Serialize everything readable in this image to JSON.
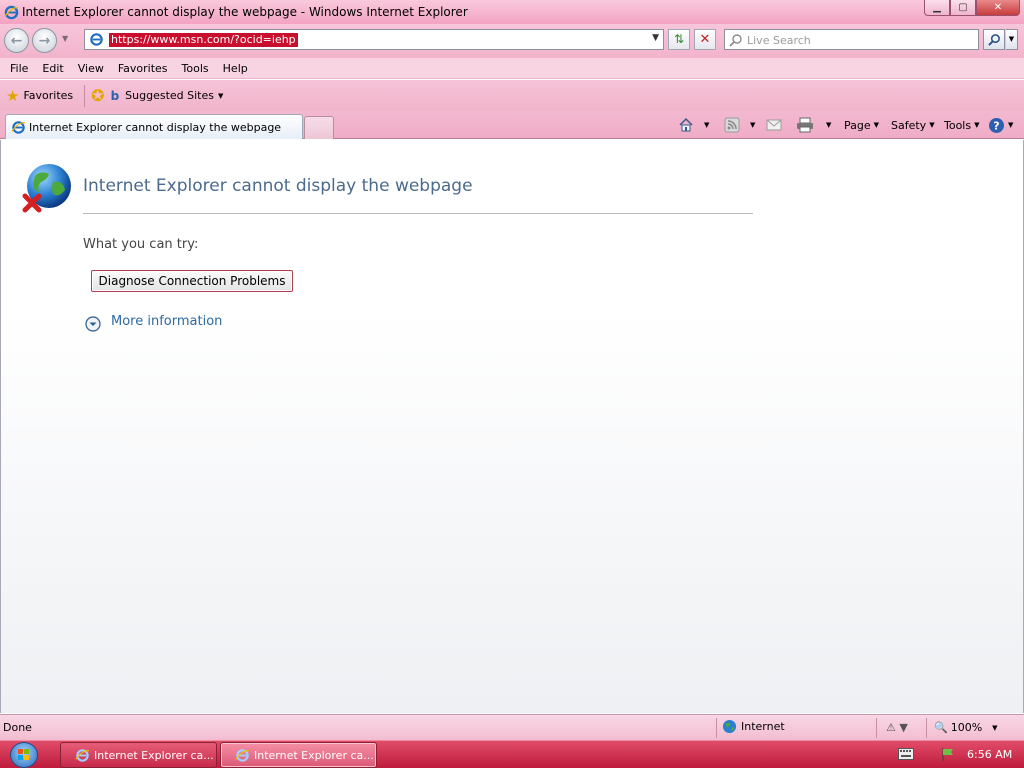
{
  "window": {
    "title": "Internet Explorer cannot display the webpage - Windows Internet Explorer",
    "minimize_label": "▁",
    "maximize_label": "▢",
    "close_label": "✕"
  },
  "address_bar": {
    "url": "https://www.msn.com/?ocid=iehp",
    "search_placeholder": "Live Search"
  },
  "menu": [
    "File",
    "Edit",
    "View",
    "Favorites",
    "Tools",
    "Help"
  ],
  "favorites_bar": {
    "favorites_label": "Favorites",
    "suggested_sites_label": "Suggested Sites"
  },
  "tab": {
    "label": "Internet Explorer cannot display the webpage"
  },
  "command_bar": {
    "page_label": "Page",
    "safety_label": "Safety",
    "tools_label": "Tools"
  },
  "content": {
    "heading": "Internet Explorer cannot display the webpage",
    "try_label": "What you can try:",
    "diagnose_button": "Diagnose Connection Problems",
    "more_info": "More information"
  },
  "status_bar": {
    "status": "Done",
    "zone": "Internet",
    "zoom": "100%"
  },
  "taskbar": {
    "items": [
      "Internet Explorer ca...",
      "Internet Explorer ca..."
    ],
    "clock": "6:56 AM"
  },
  "colors": {
    "chrome_pink": "#f3a3c2",
    "taskbar_red": "#c7294a",
    "url_highlight": "#c8102e",
    "heading_blue": "#4b6a8c",
    "link_blue": "#2c6aa0"
  }
}
